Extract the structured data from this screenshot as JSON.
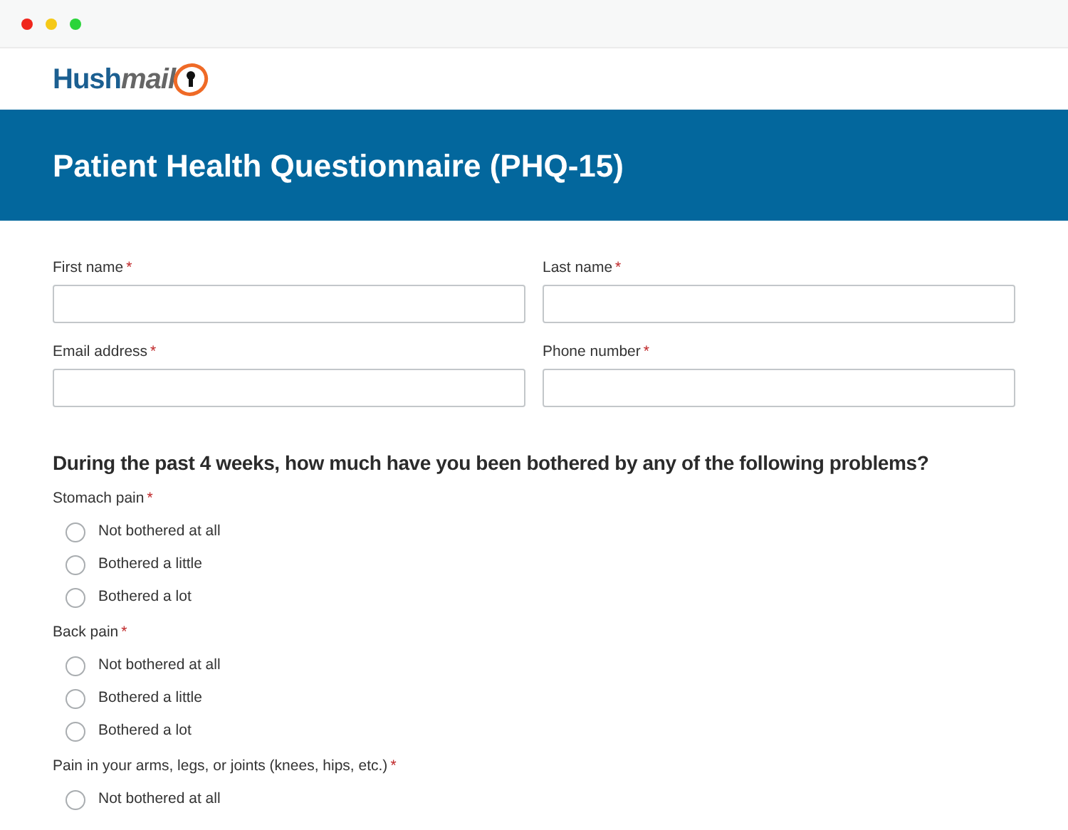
{
  "logo": {
    "first": "Hush",
    "second": "mail"
  },
  "title": "Patient Health Questionnaire (PHQ-15)",
  "fields": [
    {
      "label": "First name",
      "required_mark": "*"
    },
    {
      "label": "Last name",
      "required_mark": "*"
    },
    {
      "label": "Email address",
      "required_mark": "*"
    },
    {
      "label": "Phone number",
      "required_mark": "*"
    }
  ],
  "question": "During the past 4 weeks, how much have you been bothered by any of the following problems?",
  "items": [
    {
      "label": "Stomach pain",
      "required_mark": "*",
      "options": [
        {
          "label": "Not bothered at all",
          "selected": false
        },
        {
          "label": "Bothered a little",
          "selected": false
        },
        {
          "label": "Bothered a lot",
          "selected": false
        }
      ]
    },
    {
      "label": "Back pain",
      "required_mark": "*",
      "options": [
        {
          "label": "Not bothered at all",
          "selected": false
        },
        {
          "label": "Bothered a little",
          "selected": false
        },
        {
          "label": "Bothered a lot",
          "selected": false
        }
      ]
    },
    {
      "label": "Pain in your arms, legs, or joints (knees, hips, etc.)",
      "required_mark": "*",
      "options": [
        {
          "label": "Not bothered at all",
          "selected": false
        }
      ]
    }
  ]
}
